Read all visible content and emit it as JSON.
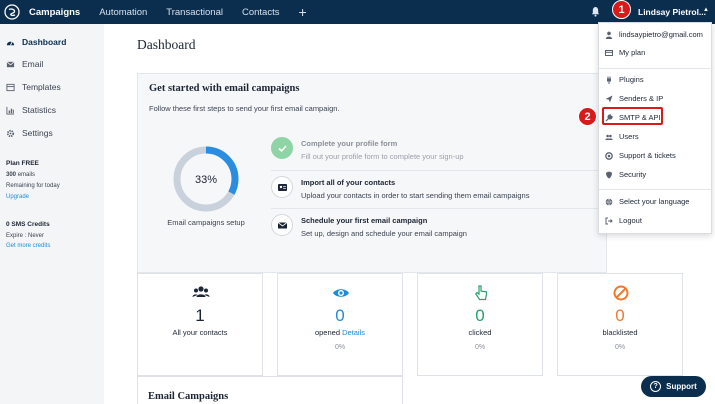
{
  "nav": {
    "items": [
      {
        "label": "Campaigns",
        "active": true
      },
      {
        "label": "Automation"
      },
      {
        "label": "Transactional"
      },
      {
        "label": "Contacts"
      }
    ],
    "plus_label": "+",
    "user_name": "Lindsay Pietrol...",
    "caret": "▲"
  },
  "markers": {
    "first": "1",
    "second": "2"
  },
  "sidebar": {
    "items": [
      {
        "label": "Dashboard",
        "icon": "dashboard-icon",
        "active": true
      },
      {
        "label": "Email",
        "icon": "email-icon"
      },
      {
        "label": "Templates",
        "icon": "templates-icon"
      },
      {
        "label": "Statistics",
        "icon": "statistics-icon"
      },
      {
        "label": "Settings",
        "icon": "settings-icon"
      }
    ],
    "plan": {
      "title": "Plan FREE",
      "emails_count": "300",
      "emails_unit": "emails",
      "remaining": "Remaining for today",
      "upgrade": "Upgrade"
    },
    "sms": {
      "title": "0 SMS Credits",
      "expire": "Expire : Never",
      "get_more": "Get more credits"
    }
  },
  "main": {
    "title": "Dashboard",
    "getting_started": {
      "title": "Get started with email campaigns",
      "subtitle": "Follow these first steps to send your first email campaign.",
      "progress_percent": 33,
      "progress_label": "33%",
      "setup_label": "Email campaigns setup",
      "steps": [
        {
          "title": "Complete your profile form",
          "desc": "Fill out your profile form to complete your sign-up",
          "done": true
        },
        {
          "title": "Import all of your contacts",
          "desc": "Upload your contacts in order to start sending them email campaigns",
          "done": false
        },
        {
          "title": "Schedule your first email campaign",
          "desc": "Set up, design and schedule your email campaign",
          "done": false
        }
      ]
    },
    "stats": [
      {
        "value": "1",
        "label": "All your contacts",
        "icon": "contacts-icon"
      },
      {
        "value": "0",
        "label": "opened",
        "link": "Details",
        "pct": "0%",
        "icon": "eye-icon"
      },
      {
        "value": "0",
        "label": "clicked",
        "pct": "0%",
        "icon": "pointer-icon"
      },
      {
        "value": "0",
        "label": "blacklisted",
        "pct": "0%",
        "icon": "blocked-icon"
      }
    ],
    "email_campaigns_title": "Email Campaigns"
  },
  "dropdown": {
    "items": [
      {
        "label": "lindsaypietro@gmail.com",
        "icon": "user-icon"
      },
      {
        "label": "My plan",
        "icon": "plan-icon"
      },
      {
        "label": "Plugins",
        "icon": "plug-icon"
      },
      {
        "label": "Senders & IP",
        "icon": "send-icon"
      },
      {
        "label": "SMTP & API",
        "icon": "wrench-icon"
      },
      {
        "label": "Users",
        "icon": "users-icon"
      },
      {
        "label": "Support & tickets",
        "icon": "lifebuoy-icon"
      },
      {
        "label": "Security",
        "icon": "shield-icon"
      },
      {
        "label": "Select your language",
        "icon": "globe-icon"
      },
      {
        "label": "Logout",
        "icon": "logout-icon"
      }
    ]
  },
  "support_label": "Support",
  "colors": {
    "nav": "#0b2e4f",
    "accent": "#1f8dd6",
    "marker": "#d91a1a",
    "done": "#8fd4a5",
    "blacklist": "#f07a2b"
  }
}
